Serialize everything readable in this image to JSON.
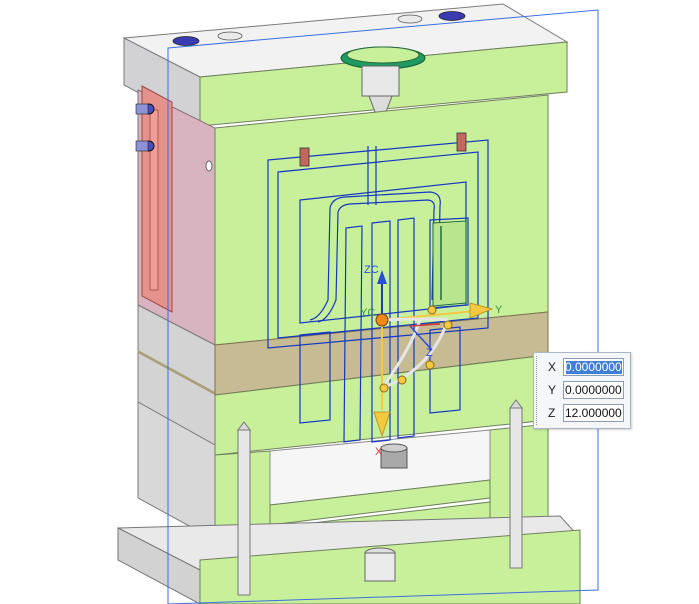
{
  "viewport": {
    "axis_labels": {
      "zc": "ZC",
      "yc": "YC",
      "y": "Y",
      "z": "Z",
      "x": "X"
    },
    "colors": {
      "face_green": "#c8f09b",
      "face_grey": "#d4d4d6",
      "face_white": "#f3f3f3",
      "slide_red": "#e6928c",
      "band_olive": "#c6bb92",
      "edge_blue": "#1437c4",
      "handle_orange": "#f08a17",
      "handle_yellow": "#f5c842"
    }
  },
  "coord_input": {
    "x_label": "X",
    "x_value": "0.0000000",
    "y_label": "Y",
    "y_value": "0.0000000",
    "z_label": "Z",
    "z_value": "12.0000000"
  }
}
